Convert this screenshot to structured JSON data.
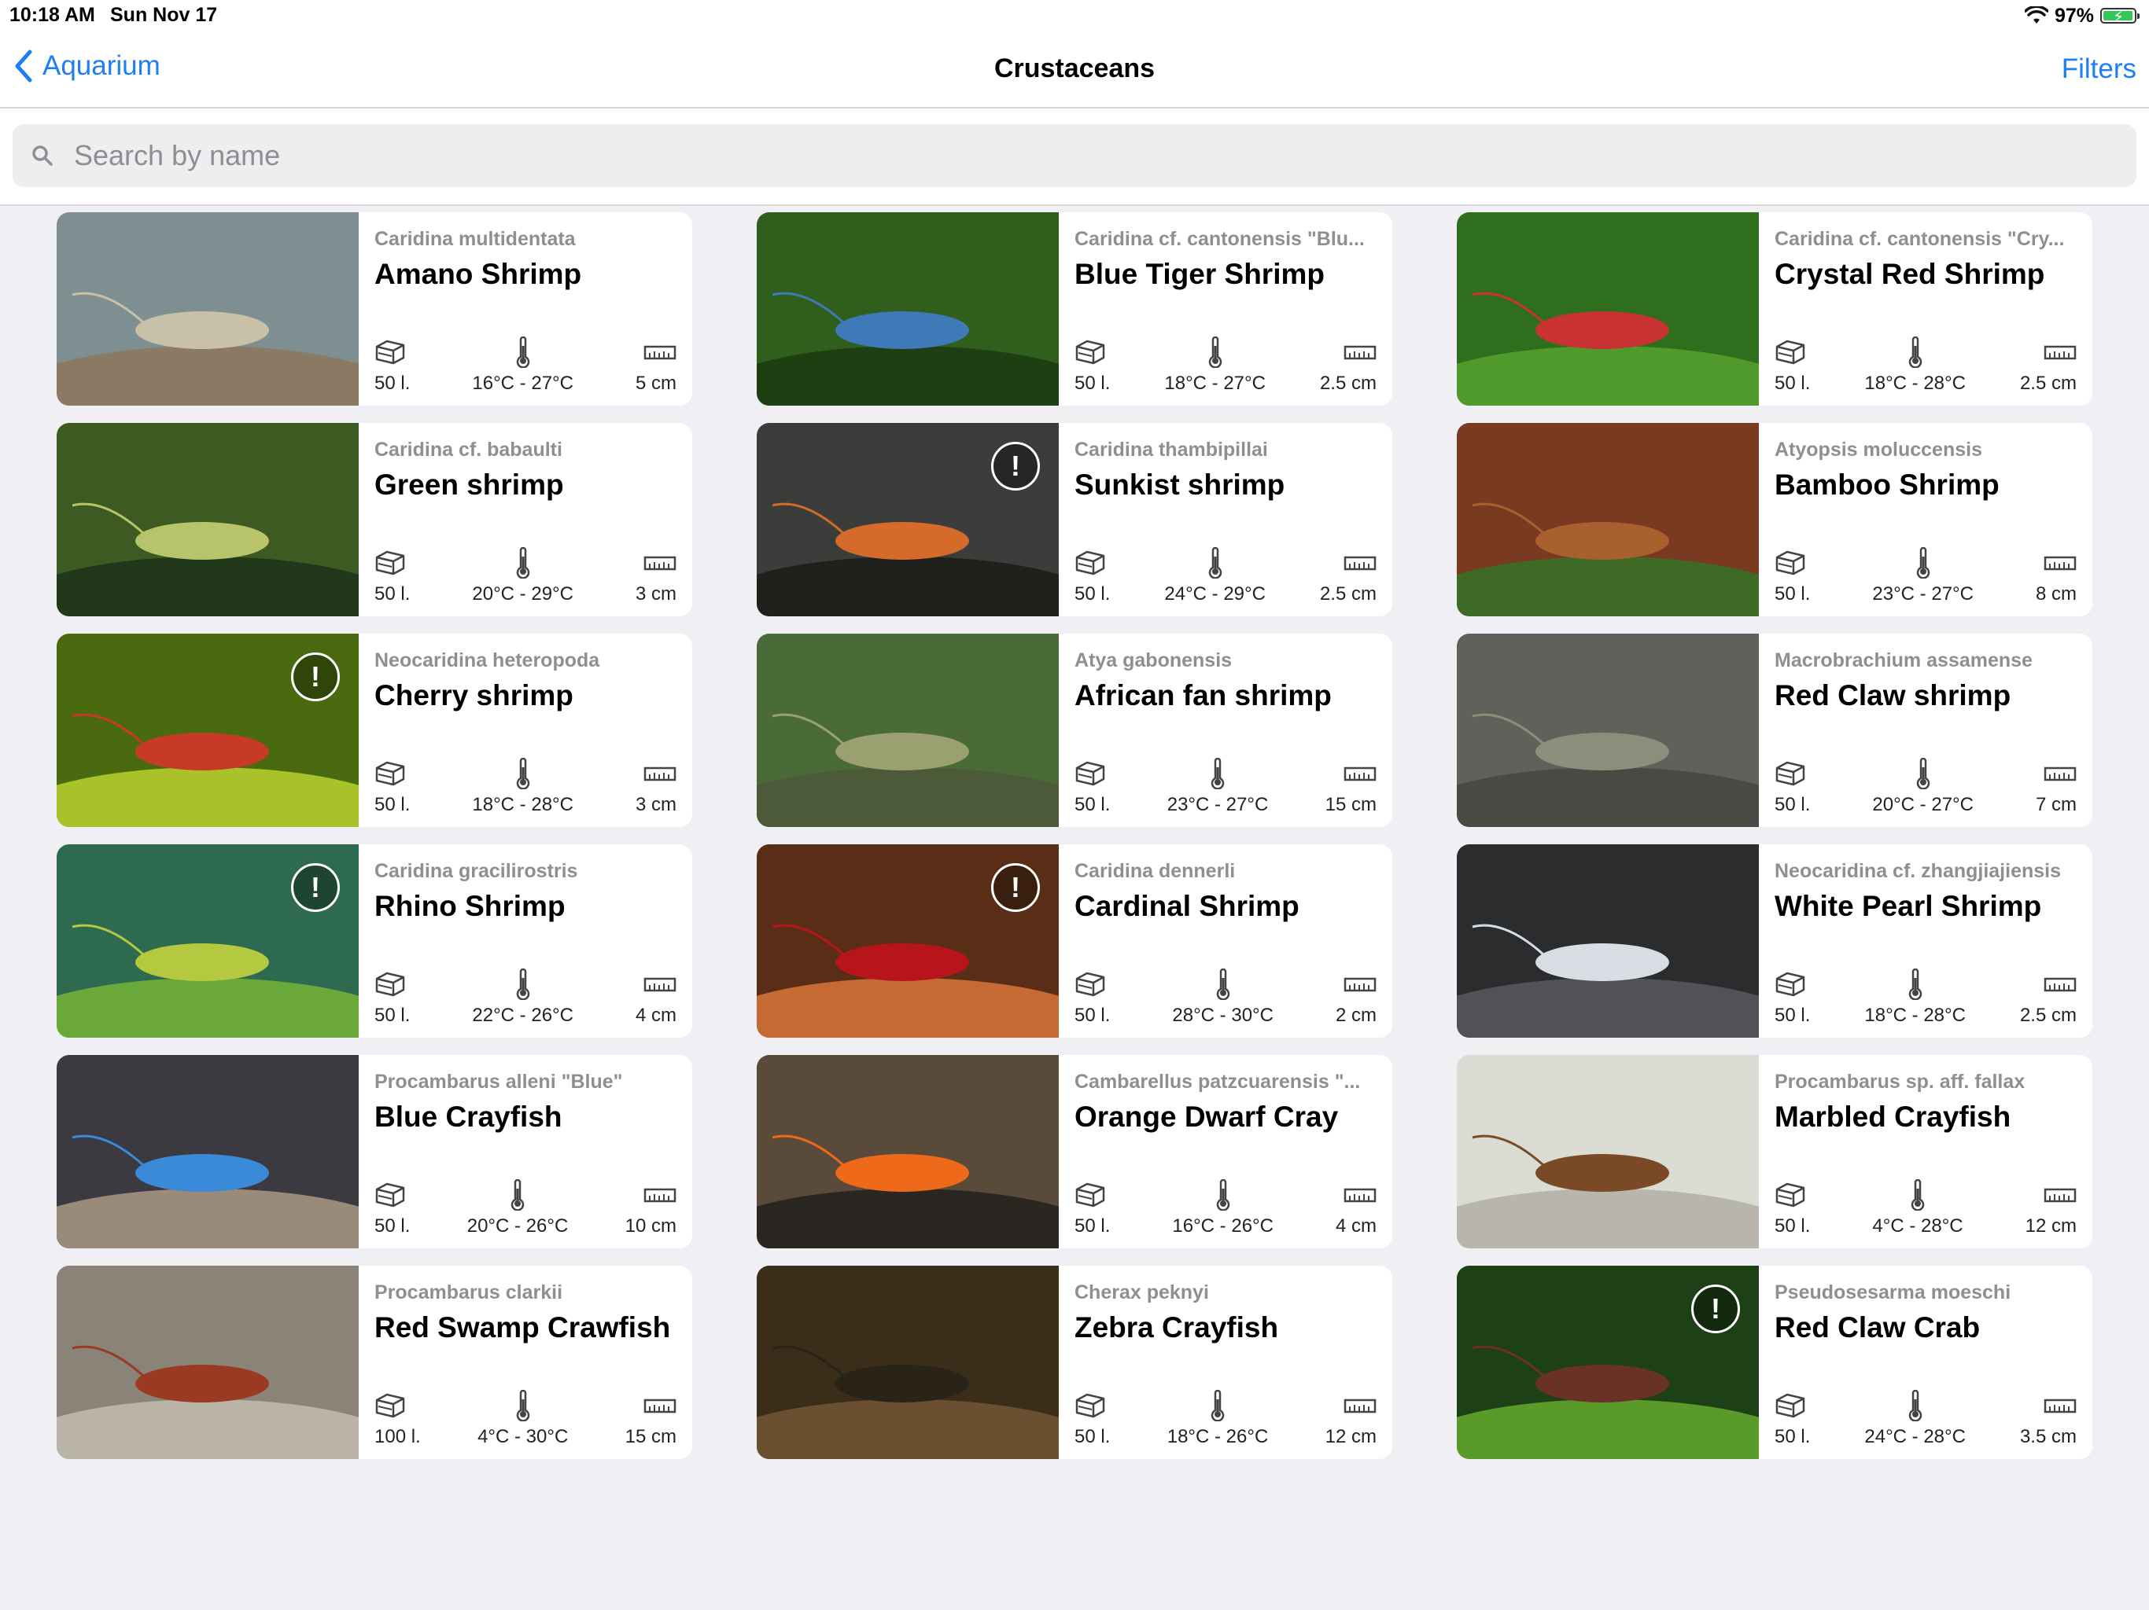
{
  "status": {
    "time": "10:18 AM",
    "date": "Sun Nov 17",
    "battery": "97%",
    "battery_level": 0.97
  },
  "nav": {
    "back_label": "Aquarium",
    "title": "Crustaceans",
    "filters_label": "Filters"
  },
  "search": {
    "placeholder": "Search by name",
    "value": ""
  },
  "icons": {
    "volume": "tank-icon",
    "temperature": "thermometer-icon",
    "size": "ruler-icon",
    "warning": "exclamation-icon"
  },
  "colors": {
    "accent": "#1d7ef5",
    "background": "#efeff4"
  },
  "items": [
    {
      "sci": "Caridina multidentata",
      "name": "Amano Shrimp",
      "volume": "50 l.",
      "temp": "16°C - 27°C",
      "size": "5 cm",
      "warn": false,
      "photo": [
        "#7e8f92",
        "#c9c0a8",
        "#8a7a63"
      ]
    },
    {
      "sci": "Caridina cf. cantonensis \"Blu...",
      "name": "Blue Tiger Shrimp",
      "volume": "50 l.",
      "temp": "18°C - 27°C",
      "size": "2.5 cm",
      "warn": false,
      "photo": [
        "#2f5e1d",
        "#3e7ab8",
        "#1e3f12"
      ]
    },
    {
      "sci": "Caridina cf. cantonensis \"Cry...",
      "name": "Crystal Red Shrimp",
      "volume": "50 l.",
      "temp": "18°C - 28°C",
      "size": "2.5 cm",
      "warn": false,
      "photo": [
        "#2f6e1c",
        "#c83232",
        "#4f9a2a"
      ]
    },
    {
      "sci": "Caridina cf. babaulti",
      "name": "Green shrimp",
      "volume": "50 l.",
      "temp": "20°C - 29°C",
      "size": "3 cm",
      "warn": false,
      "photo": [
        "#3d5a22",
        "#b8c46a",
        "#22381a"
      ]
    },
    {
      "sci": "Caridina thambipillai",
      "name": "Sunkist shrimp",
      "volume": "50 l.",
      "temp": "24°C - 29°C",
      "size": "2.5 cm",
      "warn": true,
      "photo": [
        "#3a3d3a",
        "#d56a2a",
        "#20201c"
      ]
    },
    {
      "sci": "Atyopsis moluccensis",
      "name": "Bamboo Shrimp",
      "volume": "50 l.",
      "temp": "23°C - 27°C",
      "size": "8 cm",
      "warn": false,
      "photo": [
        "#7a3a22",
        "#a8602e",
        "#3e6a26"
      ]
    },
    {
      "sci": "Neocaridina heteropoda",
      "name": "Cherry shrimp",
      "volume": "50 l.",
      "temp": "18°C - 28°C",
      "size": "3 cm",
      "warn": true,
      "photo": [
        "#4a6a10",
        "#c83a28",
        "#a9c22a"
      ]
    },
    {
      "sci": "Atya gabonensis",
      "name": "African fan shrimp",
      "volume": "50 l.",
      "temp": "23°C - 27°C",
      "size": "15 cm",
      "warn": false,
      "photo": [
        "#4a6a38",
        "#9aa070",
        "#4c5a3a"
      ]
    },
    {
      "sci": "Macrobrachium assamense",
      "name": "Red Claw shrimp",
      "volume": "50 l.",
      "temp": "20°C - 27°C",
      "size": "7 cm",
      "warn": false,
      "photo": [
        "#5e625a",
        "#8c8e7c",
        "#484a44"
      ]
    },
    {
      "sci": "Caridina gracilirostris",
      "name": "Rhino Shrimp",
      "volume": "50 l.",
      "temp": "22°C - 26°C",
      "size": "4 cm",
      "warn": true,
      "photo": [
        "#2e6a50",
        "#b4c840",
        "#6aa83a"
      ]
    },
    {
      "sci": "Caridina dennerli",
      "name": "Cardinal Shrimp",
      "volume": "50 l.",
      "temp": "28°C - 30°C",
      "size": "2 cm",
      "warn": true,
      "photo": [
        "#5a2e16",
        "#b8141c",
        "#c46a32"
      ]
    },
    {
      "sci": "Neocaridina cf. zhangjiajiensis",
      "name": "White Pearl Shrimp",
      "volume": "50 l.",
      "temp": "18°C - 28°C",
      "size": "2.5 cm",
      "warn": false,
      "photo": [
        "#2a2c2e",
        "#d8dde4",
        "#505256"
      ]
    },
    {
      "sci": "Procambarus alleni \"Blue\"",
      "name": "Blue Crayfish",
      "volume": "50 l.",
      "temp": "20°C - 26°C",
      "size": "10 cm",
      "warn": false,
      "photo": [
        "#3a3a40",
        "#3a8ad8",
        "#9a8a7a"
      ]
    },
    {
      "sci": "Cambarellus patzcuarensis \"...",
      "name": "Orange Dwarf Cray",
      "volume": "50 l.",
      "temp": "16°C - 26°C",
      "size": "4 cm",
      "warn": false,
      "photo": [
        "#5a4a3a",
        "#ee6a1a",
        "#2a2622"
      ]
    },
    {
      "sci": "Procambarus sp. aff. fallax",
      "name": "Marbled Crayfish",
      "volume": "50 l.",
      "temp": "4°C - 28°C",
      "size": "12 cm",
      "warn": false,
      "photo": [
        "#dadcd4",
        "#7a4a26",
        "#b8b6ac"
      ]
    },
    {
      "sci": "Procambarus clarkii",
      "name": "Red Swamp Crawfish",
      "volume": "100 l.",
      "temp": "4°C - 30°C",
      "size": "15 cm",
      "warn": false,
      "photo": [
        "#8a8478",
        "#9a3a22",
        "#bab4a8"
      ]
    },
    {
      "sci": "Cherax peknyi",
      "name": "Zebra Crayfish",
      "volume": "50 l.",
      "temp": "18°C - 26°C",
      "size": "12 cm",
      "warn": false,
      "photo": [
        "#3a2e1a",
        "#2a2418",
        "#6a5030"
      ]
    },
    {
      "sci": "Pseudosesarma moeschi",
      "name": "Red Claw Crab",
      "volume": "50 l.",
      "temp": "24°C - 28°C",
      "size": "3.5 cm",
      "warn": true,
      "photo": [
        "#1e4016",
        "#6a3226",
        "#5a9a2a"
      ]
    }
  ]
}
